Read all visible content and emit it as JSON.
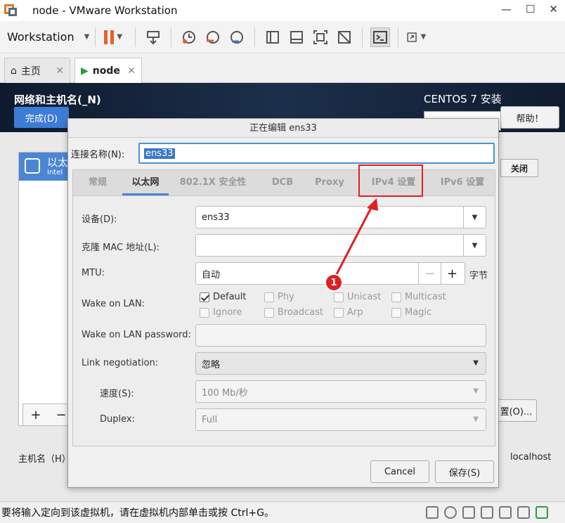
{
  "window": {
    "title": "node - VMware Workstation"
  },
  "toolbar": {
    "menu_label": "Workstation"
  },
  "tabs": [
    {
      "label": "主页"
    },
    {
      "label": "node"
    }
  ],
  "vm_header": {
    "title": "网络和主机名(_N)",
    "done_label": "完成(D)",
    "installer": "CENTOS 7 安装",
    "help_label": "帮助！"
  },
  "nic_list": {
    "item_name": "以太",
    "item_sub": "Intel",
    "add": "+",
    "remove": "−"
  },
  "close_label": "关闭",
  "configure_label": "置(O)...",
  "hostname": {
    "label": "主机名（H）",
    "value": "localhost"
  },
  "dialog": {
    "title": "正在编辑 ens33",
    "conn_name_label": "连接名称(N):",
    "conn_name_value": "ens33",
    "tabs": [
      "常规",
      "以太网",
      "802.1X 安全性",
      "DCB",
      "Proxy",
      "IPv4 设置",
      "IPv6 设置"
    ],
    "active_tab": "以太网",
    "device_label": "设备(D):",
    "device_value": "ens33",
    "mac_label": "克隆 MAC 地址(L):",
    "mac_value": "",
    "mtu_label": "MTU:",
    "mtu_value": "自动",
    "mtu_unit": "字节",
    "mtu_minus": "−",
    "mtu_plus": "+",
    "wol_label": "Wake on LAN:",
    "wol_options": [
      {
        "label": "Default",
        "checked": true
      },
      {
        "label": "Phy",
        "checked": false
      },
      {
        "label": "Unicast",
        "checked": false
      },
      {
        "label": "Multicast",
        "checked": false
      },
      {
        "label": "Ignore",
        "checked": false
      },
      {
        "label": "Broadcast",
        "checked": false
      },
      {
        "label": "Arp",
        "checked": false
      },
      {
        "label": "Magic",
        "checked": false
      }
    ],
    "wol_password_label": "Wake on LAN password:",
    "wol_password_value": "",
    "link_neg_label": "Link negotiation:",
    "link_neg_value": "忽略",
    "speed_label": "速度(S):",
    "speed_value": "100 Mb/秒",
    "duplex_label": "Duplex:",
    "duplex_value": "Full",
    "cancel_label": "Cancel",
    "save_label": "保存(S)"
  },
  "annotation": {
    "badge": "1",
    "color": "#e02020"
  },
  "status": {
    "text": "要将输入定向到该虚拟机，请在虚拟机内部单击或按 Ctrl+G。"
  }
}
